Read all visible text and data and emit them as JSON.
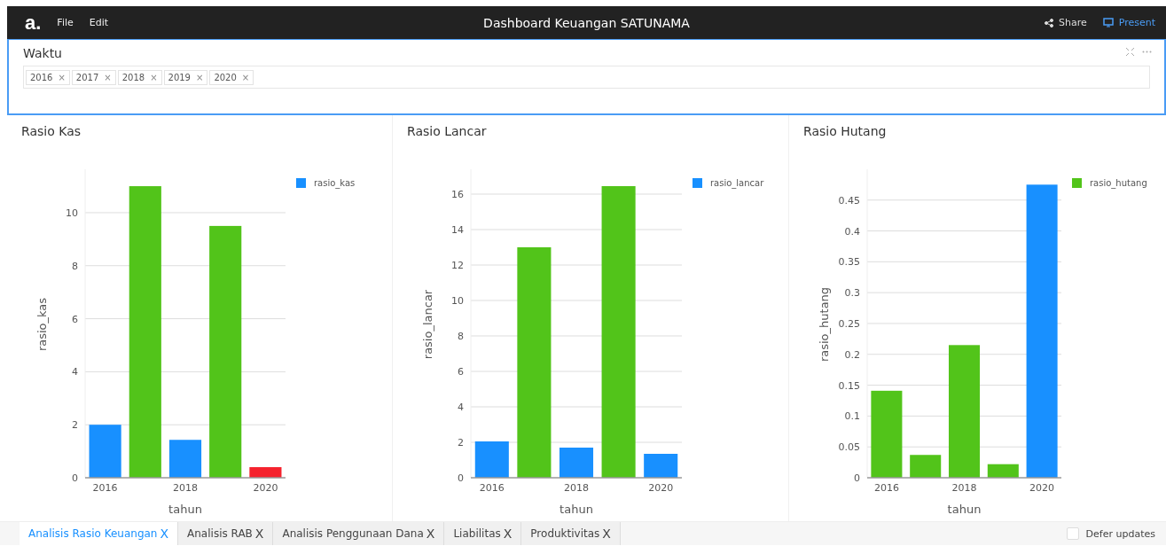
{
  "menu_bar": {
    "logo": "a.",
    "menus": [
      "File",
      "Edit"
    ],
    "title": "Dashboard Keuangan SATUNAMA",
    "actions": [
      {
        "label": "Share",
        "kind": "share",
        "selected": false
      },
      {
        "label": "Present",
        "kind": "present",
        "selected": true
      }
    ]
  },
  "filter": {
    "title": "Waktu",
    "selected": true,
    "chips": [
      {
        "label": "2016",
        "remove": "×"
      },
      {
        "label": "2017",
        "remove": "×"
      },
      {
        "label": "2018",
        "remove": "×"
      },
      {
        "label": "2019",
        "remove": "×"
      },
      {
        "label": "2020",
        "remove": "×"
      }
    ]
  },
  "panels": [
    {
      "title": "Rasio Kas",
      "chart_data": {
        "type": "bar",
        "xlabel": "tahun",
        "ylabel": "rasio_kas",
        "x": [
          2016,
          2017,
          2018,
          2019,
          2020
        ],
        "stacked": true,
        "grid": true,
        "series": [
          {
            "name": "rasio_kas",
            "color": "#1890ff",
            "values": [
              2.0,
              null,
              1.43,
              null,
              null
            ]
          },
          {
            "color": "#52c41a",
            "values": [
              null,
              11.0,
              null,
              9.5,
              null
            ]
          },
          {
            "color": "#f5222d",
            "values": [
              null,
              null,
              null,
              null,
              0.4
            ]
          }
        ],
        "xlim": [
          2015.5,
          2020.5
        ],
        "ylim": [
          0,
          11.57
        ],
        "yticks": [
          0,
          2,
          4,
          6,
          8,
          10
        ],
        "xticks": [
          2016,
          2018,
          2020
        ]
      }
    },
    {
      "title": "Rasio Lancar",
      "chart_data": {
        "type": "bar",
        "xlabel": "tahun",
        "ylabel": "rasio_lancar",
        "x": [
          2016,
          2017,
          2018,
          2019,
          2020
        ],
        "stacked": true,
        "grid": true,
        "series": [
          {
            "name": "rasio_lancar",
            "color": "#1890ff",
            "values": [
              2.05,
              null,
              1.7,
              null,
              1.35
            ]
          },
          {
            "color": "#52c41a",
            "values": [
              null,
              13.0,
              null,
              16.45,
              null
            ]
          }
        ],
        "xlim": [
          2015.5,
          2020.5
        ],
        "ylim": [
          0,
          17.3
        ],
        "yticks": [
          0,
          2,
          4,
          6,
          8,
          10,
          12,
          14,
          16
        ],
        "xticks": [
          2016,
          2018,
          2020
        ]
      }
    },
    {
      "title": "Rasio Hutang",
      "chart_data": {
        "type": "bar",
        "xlabel": "tahun",
        "ylabel": "rasio_hutang",
        "x": [
          2016,
          2017,
          2018,
          2019,
          2020
        ],
        "stacked": true,
        "grid": true,
        "series": [
          {
            "name": "rasio_hutang",
            "color": "#52c41a",
            "values": [
              0.141,
              0.037,
              0.215,
              0.022,
              null
            ]
          },
          {
            "color": "#1890ff",
            "values": [
              null,
              null,
              null,
              null,
              0.475
            ]
          }
        ],
        "xlim": [
          2015.5,
          2020.5
        ],
        "ylim": [
          0,
          0.497
        ],
        "yticks": [
          0,
          0.05,
          0.1,
          0.15,
          0.2,
          0.25,
          0.3,
          0.35,
          0.4,
          0.45
        ],
        "xticks": [
          2016,
          2018,
          2020
        ]
      }
    }
  ],
  "tabs": [
    {
      "label": "Analisis Rasio Keuangan",
      "close": "X",
      "selected": true
    },
    {
      "label": "Analisis RAB",
      "close": "X",
      "selected": false
    },
    {
      "label": "Analisis Penggunaan Dana",
      "close": "X",
      "selected": false
    },
    {
      "label": "Liabilitas",
      "close": "X",
      "selected": false
    },
    {
      "label": "Produktivitas",
      "close": "X",
      "selected": false
    }
  ],
  "defer_updates": {
    "label": "Defer updates",
    "checked": false
  }
}
